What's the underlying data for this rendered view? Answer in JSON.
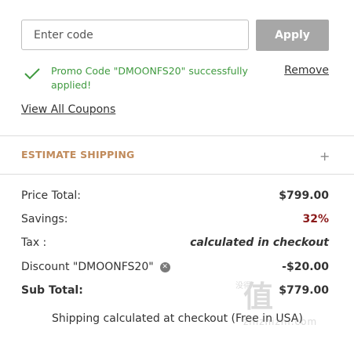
{
  "promo": {
    "input_placeholder": "Enter code",
    "input_value": "",
    "apply_label": "Apply"
  },
  "success": {
    "message": "Promo Code \"DMOONFS20\" successfully applied!",
    "remove_label": "Remove"
  },
  "view_all_coupons": "View All Coupons",
  "estimate_shipping": {
    "title": "ESTIMATE SHIPPING",
    "toggle_icon": "+"
  },
  "summary": {
    "price_total_label": "Price Total:",
    "price_total_value": "$799.00",
    "savings_label": "Savings:",
    "savings_value": "32%",
    "tax_label": "Tax :",
    "tax_value": "calculated in checkout",
    "discount_label": "Discount \"DMOONFS20\"",
    "discount_value": "-$20.00",
    "subtotal_label": "Sub Total:",
    "subtotal_value": "$779.00"
  },
  "shipping_note": "Shipping calculated at checkout (Free in USA)",
  "colors": {
    "success_green": "#3f9a3f",
    "savings_red": "#8b1a1a",
    "shipping_title": "#c08a5a",
    "apply_button": "#a7a7a7"
  },
  "watermark": {
    "big": "值",
    "small": "没得",
    "url": "zhizhizhi.com"
  }
}
